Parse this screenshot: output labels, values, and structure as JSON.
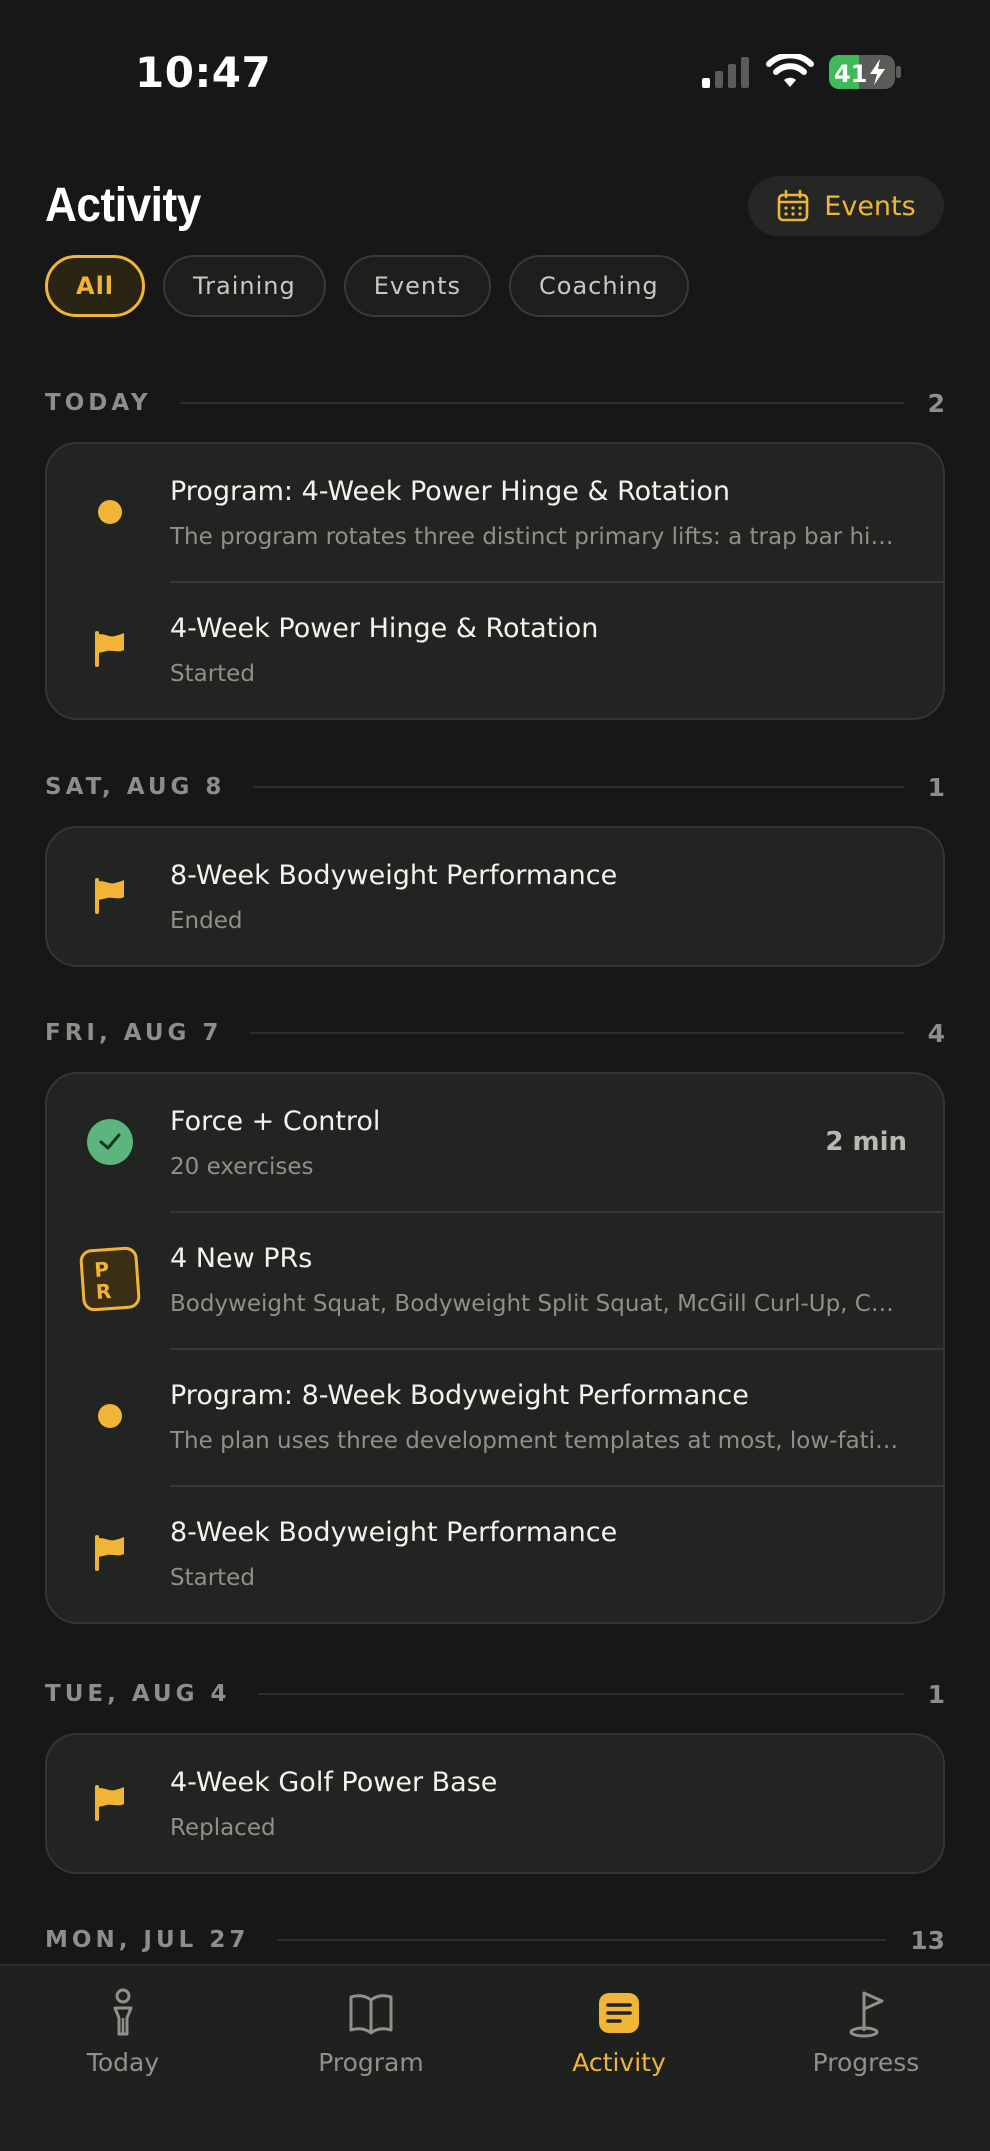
{
  "status_bar": {
    "time": "10:47",
    "battery": "41"
  },
  "header": {
    "title": "Activity",
    "events_label": "Events"
  },
  "filters": [
    "All",
    "Training",
    "Events",
    "Coaching"
  ],
  "sections": [
    {
      "label": "TODAY",
      "count": "2",
      "items": [
        {
          "icon": "dot",
          "title": "Program: 4-Week Power Hinge & Rotation",
          "subtitle": "The program rotates three distinct primary lifts: a trap bar hin..."
        },
        {
          "icon": "flag",
          "title": "4-Week Power Hinge & Rotation",
          "subtitle": "Started"
        }
      ]
    },
    {
      "label": "SAT, AUG 8",
      "count": "1",
      "items": [
        {
          "icon": "flag",
          "title": "8-Week Bodyweight Performance",
          "subtitle": "Ended"
        }
      ]
    },
    {
      "label": "FRI, AUG 7",
      "count": "4",
      "items": [
        {
          "icon": "check",
          "title": "Force + Control",
          "subtitle": "20 exercises",
          "meta": "2 min"
        },
        {
          "icon": "pr",
          "pr_text": "PR",
          "title": "4 New PRs",
          "subtitle": "Bodyweight Squat, Bodyweight Split Squat, McGill Curl-Up, Co..."
        },
        {
          "icon": "dot",
          "title": "Program: 8-Week Bodyweight Performance",
          "subtitle": "The plan uses three development templates at most, low-fatig..."
        },
        {
          "icon": "flag",
          "title": "8-Week Bodyweight Performance",
          "subtitle": "Started"
        }
      ]
    },
    {
      "label": "TUE, AUG 4",
      "count": "1",
      "items": [
        {
          "icon": "flag",
          "title": "4-Week Golf Power Base",
          "subtitle": "Replaced"
        }
      ]
    },
    {
      "label": "MON, JUL 27",
      "count": "13",
      "items": []
    }
  ],
  "nav": [
    {
      "label": "Today",
      "icon": "golfer-icon"
    },
    {
      "label": "Program",
      "icon": "book-icon"
    },
    {
      "label": "Activity",
      "icon": "activity-list-icon",
      "active": true
    },
    {
      "label": "Progress",
      "icon": "golf-flag-icon"
    }
  ],
  "colors": {
    "accent": "#f0b437",
    "background": "#161716",
    "card": "#222421",
    "success": "#5bb57c"
  }
}
